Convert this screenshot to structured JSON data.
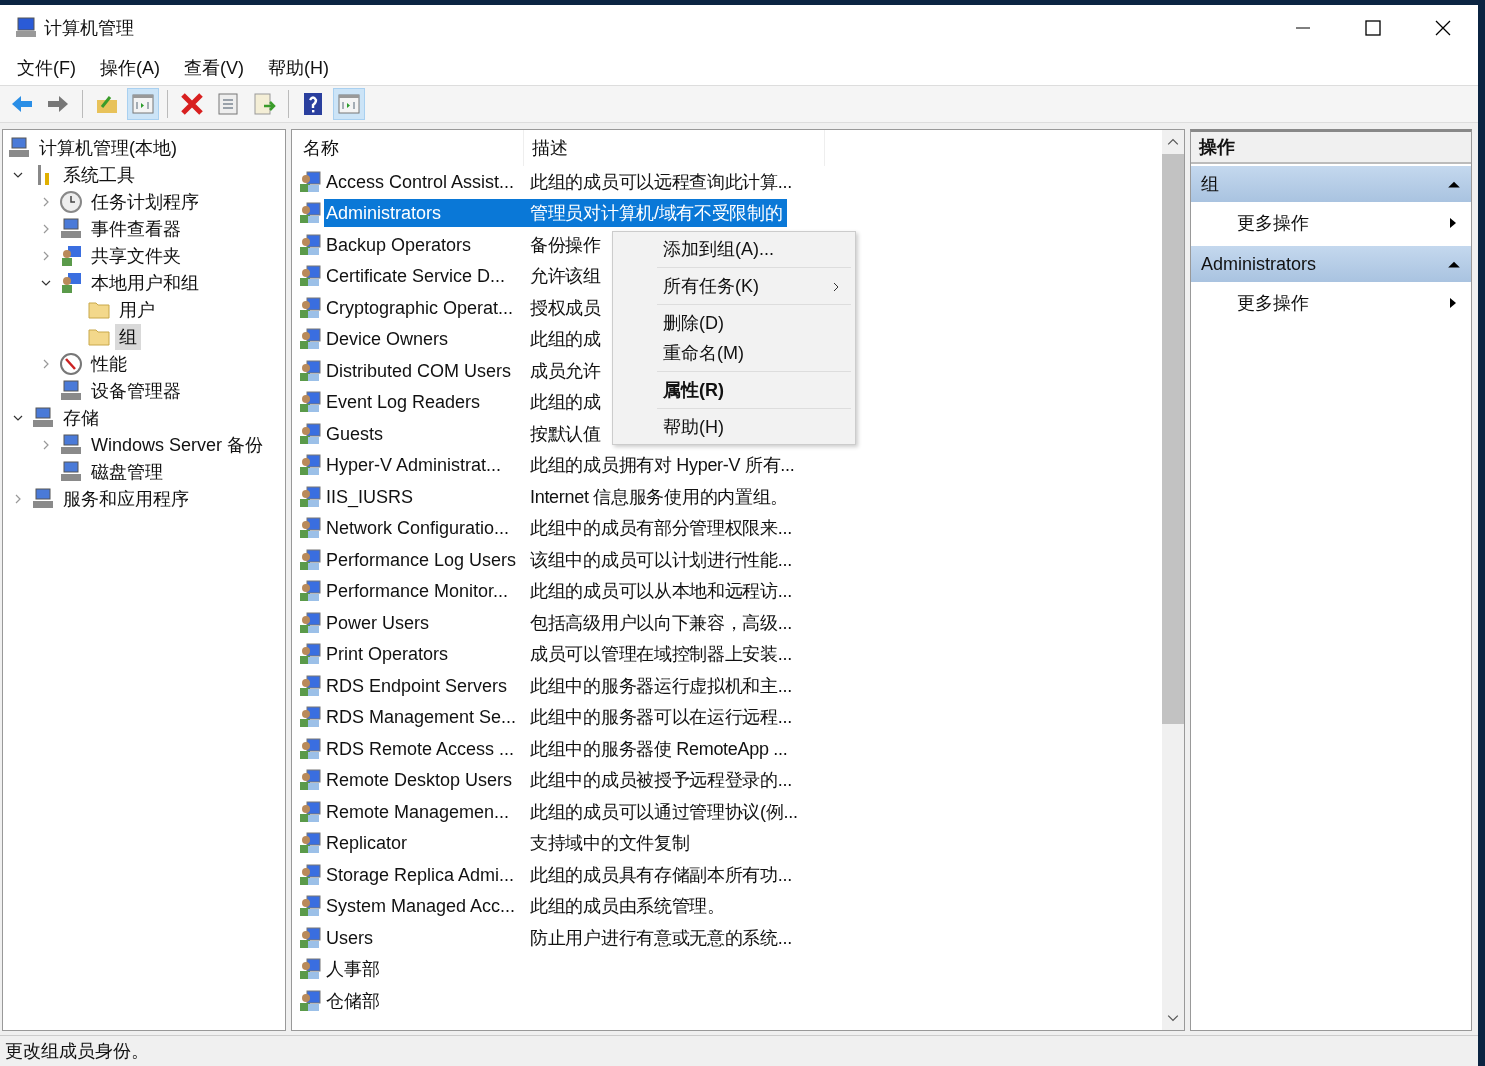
{
  "window": {
    "title": "计算机管理"
  },
  "menu": [
    "文件(F)",
    "操作(A)",
    "查看(V)",
    "帮助(H)"
  ],
  "toolbar": [
    {
      "kind": "button",
      "pressed": false
    },
    {
      "kind": "button",
      "pressed": false
    },
    {
      "kind": "separator"
    },
    {
      "kind": "button",
      "pressed": false
    },
    {
      "kind": "button",
      "pressed": true
    },
    {
      "kind": "separator"
    },
    {
      "kind": "button",
      "pressed": false
    },
    {
      "kind": "button",
      "pressed": false
    },
    {
      "kind": "button",
      "pressed": false
    },
    {
      "kind": "separator"
    },
    {
      "kind": "button",
      "pressed": false
    },
    {
      "kind": "button",
      "pressed": true
    }
  ],
  "tree": [
    {
      "label": "计算机管理(本地)",
      "selected": false,
      "children": [
        {
          "label": "系统工具",
          "expanded": true,
          "selected": false,
          "children": [
            {
              "label": "任务计划程序",
              "expanded": false,
              "selected": false
            },
            {
              "label": "事件查看器",
              "expanded": false,
              "selected": false
            },
            {
              "label": "共享文件夹",
              "expanded": false,
              "selected": false
            },
            {
              "label": "本地用户和组",
              "expanded": true,
              "selected": false,
              "children": [
                {
                  "label": "用户",
                  "selected": false
                },
                {
                  "label": "组",
                  "selected": true
                }
              ]
            },
            {
              "label": "性能",
              "expanded": false,
              "selected": false
            },
            {
              "label": "设备管理器",
              "selected": false
            }
          ]
        },
        {
          "label": "存储",
          "expanded": true,
          "selected": false,
          "children": [
            {
              "label": "Windows Server 备份",
              "expanded": false,
              "selected": false
            },
            {
              "label": "磁盘管理",
              "selected": false
            }
          ]
        },
        {
          "label": "服务和应用程序",
          "expanded": false,
          "selected": false
        }
      ]
    }
  ],
  "table": {
    "columns": [
      "名称",
      "描述"
    ],
    "rows": [
      {
        "name": "Access Control Assist...",
        "description": "此组的成员可以远程查询此计算...",
        "selected": false
      },
      {
        "name": "Administrators",
        "description": "管理员对计算机/域有不受限制的",
        "selected": true
      },
      {
        "name": "Backup Operators",
        "description": "备份操作",
        "selected": false
      },
      {
        "name": "Certificate Service D...",
        "description": "允许该组",
        "selected": false
      },
      {
        "name": "Cryptographic Operat...",
        "description": "授权成员",
        "selected": false
      },
      {
        "name": "Device Owners",
        "description": "此组的成",
        "selected": false
      },
      {
        "name": "Distributed COM Users",
        "description": "成员允许",
        "selected": false
      },
      {
        "name": "Event Log Readers",
        "description": "此组的成",
        "selected": false
      },
      {
        "name": "Guests",
        "description": "按默认值",
        "selected": false
      },
      {
        "name": "Hyper-V Administrat...",
        "description": "此组的成员拥有对 Hyper-V 所有...",
        "selected": false
      },
      {
        "name": "IIS_IUSRS",
        "description": "Internet 信息服务使用的内置组。",
        "selected": false
      },
      {
        "name": "Network Configuratio...",
        "description": "此组中的成员有部分管理权限来...",
        "selected": false
      },
      {
        "name": "Performance Log Users",
        "description": "该组中的成员可以计划进行性能...",
        "selected": false
      },
      {
        "name": "Performance Monitor...",
        "description": "此组的成员可以从本地和远程访...",
        "selected": false
      },
      {
        "name": "Power Users",
        "description": "包括高级用户以向下兼容，高级...",
        "selected": false
      },
      {
        "name": "Print Operators",
        "description": "成员可以管理在域控制器上安装...",
        "selected": false
      },
      {
        "name": "RDS Endpoint Servers",
        "description": "此组中的服务器运行虚拟机和主...",
        "selected": false
      },
      {
        "name": "RDS Management Se...",
        "description": "此组中的服务器可以在运行远程...",
        "selected": false
      },
      {
        "name": "RDS Remote Access ...",
        "description": "此组中的服务器使 RemoteApp ...",
        "selected": false
      },
      {
        "name": "Remote Desktop Users",
        "description": "此组中的成员被授予远程登录的...",
        "selected": false
      },
      {
        "name": "Remote Managemen...",
        "description": "此组的成员可以通过管理协议(例...",
        "selected": false
      },
      {
        "name": "Replicator",
        "description": "支持域中的文件复制",
        "selected": false
      },
      {
        "name": "Storage Replica Admi...",
        "description": "此组的成员具有存储副本所有功...",
        "selected": false
      },
      {
        "name": "System Managed Acc...",
        "description": "此组的成员由系统管理。",
        "selected": false
      },
      {
        "name": "Users",
        "description": "防止用户进行有意或无意的系统...",
        "selected": false
      },
      {
        "name": "人事部",
        "selected": false
      },
      {
        "name": "仓储部",
        "selected": false
      }
    ]
  },
  "context_menu": [
    {
      "kind": "item",
      "label": "添加到组(A)..."
    },
    {
      "kind": "separator"
    },
    {
      "kind": "submenu",
      "label": "所有任务(K)"
    },
    {
      "kind": "separator"
    },
    {
      "kind": "item",
      "label": "删除(D)"
    },
    {
      "kind": "item",
      "label": "重命名(M)"
    },
    {
      "kind": "separator"
    },
    {
      "kind": "default",
      "label": "属性(R)"
    },
    {
      "kind": "separator"
    },
    {
      "kind": "item",
      "label": "帮助(H)"
    }
  ],
  "actions": {
    "title": "操作",
    "sections": [
      {
        "title": "组",
        "expanded": true,
        "items": [
          "更多操作"
        ]
      },
      {
        "title": "Administrators",
        "expanded": true,
        "items": [
          "更多操作"
        ]
      }
    ]
  },
  "status_bar": "更改组成员身份。"
}
